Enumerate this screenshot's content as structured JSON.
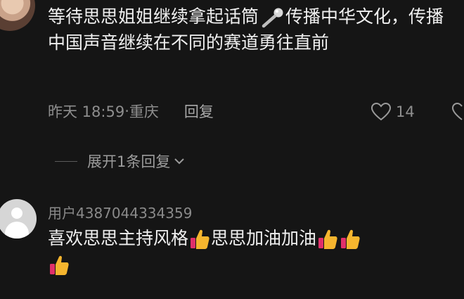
{
  "comment1": {
    "text_part1": "等待思思姐姐继续拿起话筒",
    "text_part2": "传播中华文化，传播中国声音继续在不同的赛道勇往直前",
    "mic_icon": "microphone-icon",
    "time": "昨天 18:59",
    "location_sep": "·",
    "location": "重庆",
    "reply_label": "回复",
    "like_count": "14"
  },
  "expand": {
    "label": "展开1条回复"
  },
  "comment2": {
    "username": "用户4387044334359",
    "text_part1": "喜欢思思主持风格",
    "text_part2": "思思加油加油",
    "emoji": "thumbs-up-icon"
  }
}
